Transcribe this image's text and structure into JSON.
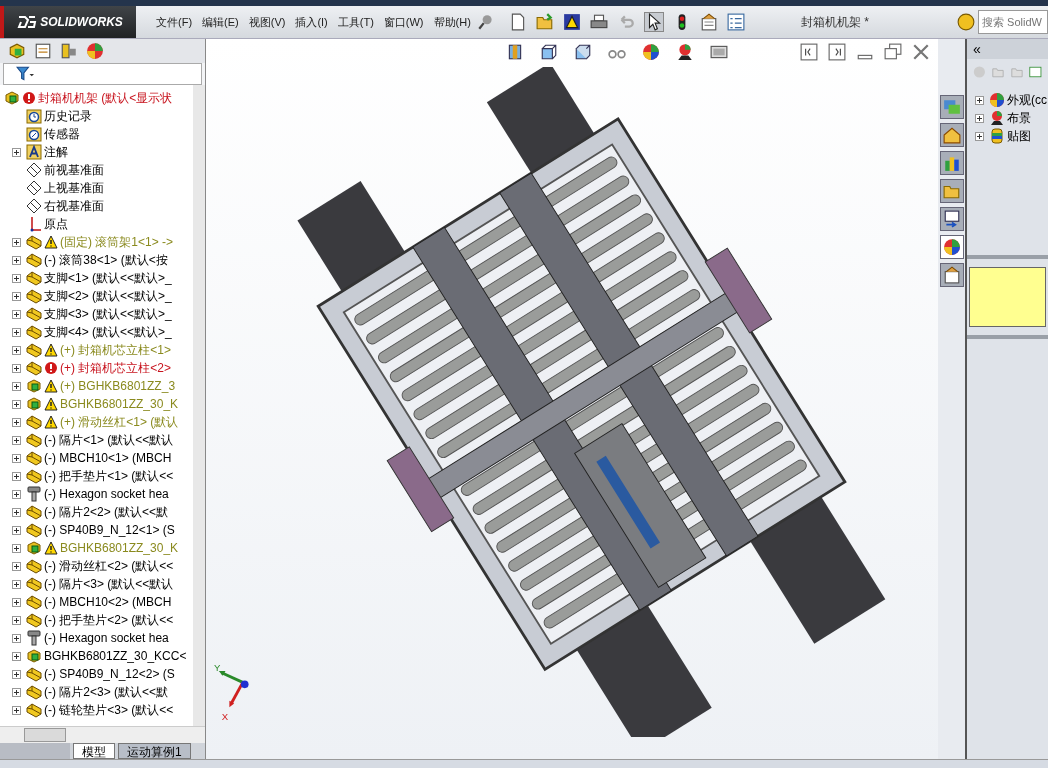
{
  "app": {
    "logo": "SOLIDWORKS",
    "document_title": "封箱机机架 *",
    "search": {
      "placeholder": "搜索 SolidW"
    }
  },
  "menu": [
    "文件(F)",
    "编辑(E)",
    "视图(V)",
    "插入(I)",
    "工具(T)",
    "窗口(W)",
    "帮助(H)"
  ],
  "feature_tree": {
    "root": {
      "label": "封箱机机架  (默认<显示状",
      "kind": "assembly",
      "warning": false,
      "error": true,
      "children": [
        {
          "label": "历史记录",
          "kind": "history",
          "warning": false,
          "error": false,
          "expandable": false
        },
        {
          "label": "传感器",
          "kind": "sensor",
          "warning": false,
          "error": false,
          "expandable": false
        },
        {
          "label": "注解",
          "kind": "annotation",
          "warning": false,
          "error": false,
          "expandable": true
        },
        {
          "label": "前视基准面",
          "kind": "plane",
          "warning": false,
          "error": false,
          "expandable": false
        },
        {
          "label": "上视基准面",
          "kind": "plane",
          "warning": false,
          "error": false,
          "expandable": false
        },
        {
          "label": "右视基准面",
          "kind": "plane",
          "warning": false,
          "error": false,
          "expandable": false
        },
        {
          "label": "原点",
          "kind": "origin",
          "warning": false,
          "error": false,
          "expandable": false
        },
        {
          "label": "(固定) 滚筒架1<1> ->",
          "kind": "subassembly",
          "warning": true,
          "error": false,
          "expandable": true
        },
        {
          "label": "(-) 滚筒38<1> (默认<按",
          "kind": "subassembly",
          "warning": false,
          "error": false,
          "expandable": true
        },
        {
          "label": "支脚<1> (默认<<默认>_",
          "kind": "subassembly",
          "warning": false,
          "error": false,
          "expandable": true
        },
        {
          "label": "支脚<2> (默认<<默认>_",
          "kind": "subassembly",
          "warning": false,
          "error": false,
          "expandable": true
        },
        {
          "label": "支脚<3> (默认<<默认>_",
          "kind": "subassembly",
          "warning": false,
          "error": false,
          "expandable": true
        },
        {
          "label": "支脚<4> (默认<<默认>_",
          "kind": "subassembly",
          "warning": false,
          "error": false,
          "expandable": true
        },
        {
          "label": "(+) 封箱机芯立柱<1>",
          "kind": "subassembly",
          "warning": true,
          "error": false,
          "expandable": true
        },
        {
          "label": "(+) 封箱机芯立柱<2>",
          "kind": "subassembly",
          "warning": false,
          "error": true,
          "expandable": true
        },
        {
          "label": "(+) BGHKB6801ZZ_3",
          "kind": "assembly",
          "warning": true,
          "error": false,
          "expandable": true
        },
        {
          "label": "BGHKB6801ZZ_30_K",
          "kind": "assembly",
          "warning": true,
          "error": false,
          "expandable": true
        },
        {
          "label": "(+) 滑动丝杠<1> (默认",
          "kind": "subassembly",
          "warning": true,
          "error": false,
          "expandable": true
        },
        {
          "label": "(-) 隔片<1> (默认<<默认",
          "kind": "subassembly",
          "warning": false,
          "error": false,
          "expandable": true
        },
        {
          "label": "(-) MBCH10<1> (MBCH",
          "kind": "subassembly",
          "warning": false,
          "error": false,
          "expandable": true
        },
        {
          "label": "(-) 把手垫片<1> (默认<<",
          "kind": "subassembly",
          "warning": false,
          "error": false,
          "expandable": true
        },
        {
          "label": "(-) Hexagon socket hea",
          "kind": "screw",
          "warning": false,
          "error": false,
          "expandable": true
        },
        {
          "label": "(-) 隔片2<2> (默认<<默",
          "kind": "subassembly",
          "warning": false,
          "error": false,
          "expandable": true
        },
        {
          "label": "(-) SP40B9_N_12<1> (S",
          "kind": "subassembly",
          "warning": false,
          "error": false,
          "expandable": true
        },
        {
          "label": "BGHKB6801ZZ_30_K",
          "kind": "assembly",
          "warning": true,
          "error": false,
          "expandable": true
        },
        {
          "label": "(-) 滑动丝杠<2> (默认<<",
          "kind": "subassembly",
          "warning": false,
          "error": false,
          "expandable": true
        },
        {
          "label": "(-) 隔片<3> (默认<<默认",
          "kind": "subassembly",
          "warning": false,
          "error": false,
          "expandable": true
        },
        {
          "label": "(-) MBCH10<2> (MBCH",
          "kind": "subassembly",
          "warning": false,
          "error": false,
          "expandable": true
        },
        {
          "label": "(-) 把手垫片<2> (默认<<",
          "kind": "subassembly",
          "warning": false,
          "error": false,
          "expandable": true
        },
        {
          "label": "(-) Hexagon socket hea",
          "kind": "screw",
          "warning": false,
          "error": false,
          "expandable": true
        },
        {
          "label": "BGHKB6801ZZ_30_KCC<",
          "kind": "assembly",
          "warning": false,
          "error": false,
          "expandable": true
        },
        {
          "label": "(-) SP40B9_N_12<2> (S",
          "kind": "subassembly",
          "warning": false,
          "error": false,
          "expandable": true
        },
        {
          "label": "(-) 隔片2<3> (默认<<默",
          "kind": "subassembly",
          "warning": false,
          "error": false,
          "expandable": true
        },
        {
          "label": "(-) 链轮垫片<3> (默认<<",
          "kind": "subassembly",
          "warning": false,
          "error": false,
          "expandable": true
        }
      ]
    }
  },
  "bottom_tabs": [
    {
      "label": "模型",
      "selected": true
    },
    {
      "label": "运动算例1",
      "selected": false
    }
  ],
  "triad": {
    "y_label": "Y",
    "x_label": "X"
  },
  "task_pane": {
    "collapse_label": "«",
    "items": [
      {
        "label": "外观(cc",
        "kind": "appearance",
        "expandable": true
      },
      {
        "label": "布景",
        "kind": "scene",
        "expandable": true
      },
      {
        "label": "贴图",
        "kind": "decal",
        "expandable": true
      }
    ]
  }
}
